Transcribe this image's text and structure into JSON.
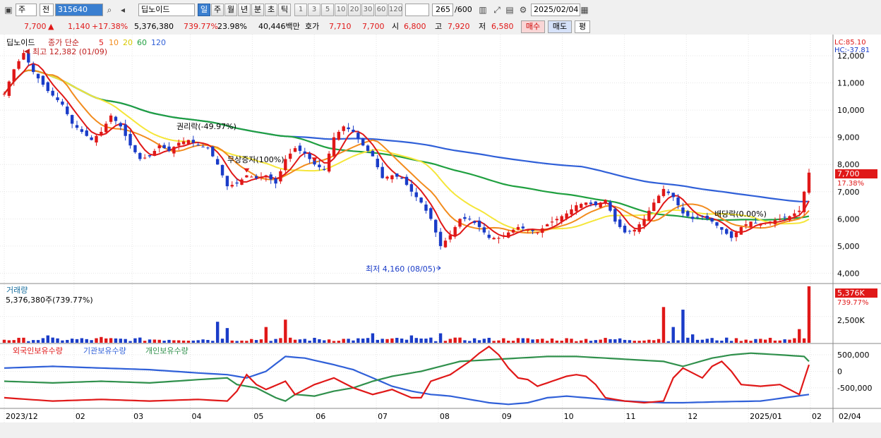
{
  "toolbar": {
    "market": "주",
    "mode": "전",
    "code": "315640",
    "name": "딥노이드",
    "periods": [
      "일",
      "주",
      "월",
      "년",
      "분",
      "초",
      "틱"
    ],
    "selected_period": "일",
    "ticks": [
      "1",
      "3",
      "5",
      "10",
      "20",
      "30",
      "60",
      "120"
    ],
    "count": "265",
    "count_total": "/600",
    "date": "2025/02/04"
  },
  "quote": {
    "price": "7,700",
    "change_arrow": "▲",
    "change": "1,140",
    "change_pct": "+17.38%",
    "volume": "5,376,380",
    "volume_ratio": "739.77%",
    "turnover": "23.98%",
    "amount": "40,446백만",
    "ask_label": "호가",
    "ask": "7,710",
    "bid": "7,700",
    "open_label": "시",
    "open": "6,800",
    "high_label": "고",
    "high": "7,920",
    "low_label": "저",
    "low": "6,580",
    "buy": "매수",
    "sell": "매도",
    "eval": "평"
  },
  "colors": {
    "up": "#e01818",
    "down": "#1a3cc8",
    "ma5": "#e01818",
    "ma10": "#f28c1e",
    "ma20": "#f5e63a",
    "ma60": "#20a040",
    "ma120": "#3060d8",
    "foreign": "#e01818",
    "institution": "#3060d8",
    "individual": "#30904c"
  },
  "chart_data": [
    {
      "type": "candlestick",
      "title": "딥노이드",
      "legend": [
        "종가 단순",
        "5",
        "10",
        "20",
        "60",
        "120"
      ],
      "ylim": [
        3700,
        12700
      ],
      "yticks": [
        "12,000",
        "11,000",
        "10,000",
        "9,000",
        "8,000",
        "7,000",
        "6,000",
        "5,000",
        "4,000"
      ],
      "corner_labels": [
        "LC:85.10",
        "HC:-37.81"
      ],
      "current_price": "7,700",
      "current_pct": "17.38%",
      "annotations": {
        "high": "최고 12,382 (01/09)",
        "low": "최저 4,160 (08/05)",
        "event1": "권리락(-49.97%)",
        "event2": "무상증자(100%)",
        "event3": "배당락(0.00%)"
      },
      "close_path": [
        [
          0,
          10600
        ],
        [
          2,
          11500
        ],
        [
          4,
          12100
        ],
        [
          6,
          11400
        ],
        [
          9,
          10700
        ],
        [
          12,
          10200
        ],
        [
          14,
          9500
        ],
        [
          16,
          9200
        ],
        [
          18,
          8900
        ],
        [
          20,
          9200
        ],
        [
          22,
          9800
        ],
        [
          24,
          9400
        ],
        [
          26,
          8700
        ],
        [
          28,
          8200
        ],
        [
          30,
          8300
        ],
        [
          32,
          8700
        ],
        [
          34,
          8500
        ],
        [
          36,
          8800
        ],
        [
          38,
          8900
        ],
        [
          40,
          8700
        ],
        [
          42,
          8600
        ],
        [
          44,
          8000
        ],
        [
          46,
          7200
        ],
        [
          48,
          7300
        ],
        [
          50,
          7600
        ],
        [
          52,
          7500
        ],
        [
          54,
          7600
        ],
        [
          56,
          7300
        ],
        [
          58,
          8200
        ],
        [
          60,
          8600
        ],
        [
          62,
          8400
        ],
        [
          64,
          8000
        ],
        [
          66,
          7800
        ],
        [
          68,
          9000
        ],
        [
          70,
          9400
        ],
        [
          72,
          9200
        ],
        [
          74,
          8700
        ],
        [
          76,
          8300
        ],
        [
          78,
          7500
        ],
        [
          80,
          7600
        ],
        [
          82,
          7500
        ],
        [
          84,
          7000
        ],
        [
          86,
          6600
        ],
        [
          88,
          6000
        ],
        [
          90,
          5000
        ],
        [
          92,
          5400
        ],
        [
          94,
          6000
        ],
        [
          96,
          6000
        ],
        [
          98,
          5700
        ],
        [
          100,
          5300
        ],
        [
          102,
          5300
        ],
        [
          104,
          5500
        ],
        [
          106,
          5700
        ],
        [
          108,
          5600
        ],
        [
          110,
          5500
        ],
        [
          112,
          5800
        ],
        [
          114,
          6000
        ],
        [
          116,
          6200
        ],
        [
          118,
          6500
        ],
        [
          120,
          6600
        ],
        [
          122,
          6500
        ],
        [
          124,
          6700
        ],
        [
          126,
          5900
        ],
        [
          128,
          5500
        ],
        [
          130,
          5600
        ],
        [
          132,
          6000
        ],
        [
          134,
          6600
        ],
        [
          136,
          7100
        ],
        [
          138,
          6800
        ],
        [
          140,
          6200
        ],
        [
          142,
          6000
        ],
        [
          144,
          6100
        ],
        [
          146,
          5900
        ],
        [
          148,
          5600
        ],
        [
          150,
          5300
        ],
        [
          152,
          5700
        ],
        [
          154,
          5900
        ],
        [
          156,
          5800
        ],
        [
          158,
          5900
        ],
        [
          160,
          6000
        ],
        [
          162,
          6100
        ],
        [
          164,
          6300
        ],
        [
          166,
          7700
        ]
      ],
      "volume": {
        "label": "거래량",
        "value_text": "5,376,380주(739.77%)",
        "current": "5,376K",
        "current_pct": "739.77%",
        "ytick": "2,500K",
        "ylim": [
          0,
          5500
        ],
        "bars_k": [
          [
            9,
            700
          ],
          [
            20,
            550
          ],
          [
            44,
            2000
          ],
          [
            46,
            1400
          ],
          [
            54,
            1500
          ],
          [
            58,
            2200
          ],
          [
            76,
            900
          ],
          [
            84,
            700
          ],
          [
            90,
            900
          ],
          [
            136,
            3400
          ],
          [
            138,
            1500
          ],
          [
            140,
            3150
          ],
          [
            142,
            800
          ],
          [
            164,
            1300
          ],
          [
            166,
            5376
          ]
        ]
      },
      "holdings": {
        "labels": [
          "외국인보유수량",
          "기관보유수량",
          "개인보유수량"
        ],
        "yticks": [
          "500,000",
          "0",
          "-500,000"
        ],
        "ylim": [
          -1100000,
          800000
        ],
        "foreign": [
          [
            0,
            -800000
          ],
          [
            10,
            -900000
          ],
          [
            20,
            -850000
          ],
          [
            30,
            -900000
          ],
          [
            40,
            -850000
          ],
          [
            46,
            -900000
          ],
          [
            48,
            -600000
          ],
          [
            50,
            -100000
          ],
          [
            52,
            -400000
          ],
          [
            54,
            -550000
          ],
          [
            58,
            -300000
          ],
          [
            60,
            -700000
          ],
          [
            64,
            -400000
          ],
          [
            68,
            -200000
          ],
          [
            72,
            -500000
          ],
          [
            76,
            -700000
          ],
          [
            80,
            -550000
          ],
          [
            84,
            -800000
          ],
          [
            86,
            -800000
          ],
          [
            88,
            -300000
          ],
          [
            92,
            -100000
          ],
          [
            96,
            300000
          ],
          [
            98,
            550000
          ],
          [
            100,
            750000
          ],
          [
            102,
            500000
          ],
          [
            104,
            100000
          ],
          [
            106,
            -200000
          ],
          [
            108,
            -250000
          ],
          [
            110,
            -450000
          ],
          [
            112,
            -350000
          ],
          [
            114,
            -250000
          ],
          [
            116,
            -150000
          ],
          [
            118,
            -100000
          ],
          [
            120,
            -150000
          ],
          [
            122,
            -400000
          ],
          [
            124,
            -800000
          ],
          [
            128,
            -900000
          ],
          [
            132,
            -950000
          ],
          [
            136,
            -900000
          ],
          [
            138,
            -200000
          ],
          [
            140,
            100000
          ],
          [
            144,
            -200000
          ],
          [
            146,
            150000
          ],
          [
            148,
            300000
          ],
          [
            150,
            0
          ],
          [
            152,
            -400000
          ],
          [
            156,
            -450000
          ],
          [
            160,
            -400000
          ],
          [
            164,
            -700000
          ],
          [
            166,
            200000
          ]
        ],
        "institution": [
          [
            0,
            100000
          ],
          [
            10,
            150000
          ],
          [
            20,
            100000
          ],
          [
            30,
            50000
          ],
          [
            40,
            -50000
          ],
          [
            46,
            -100000
          ],
          [
            50,
            -200000
          ],
          [
            54,
            0
          ],
          [
            58,
            450000
          ],
          [
            62,
            400000
          ],
          [
            68,
            200000
          ],
          [
            72,
            50000
          ],
          [
            76,
            -200000
          ],
          [
            80,
            -450000
          ],
          [
            84,
            -600000
          ],
          [
            88,
            -700000
          ],
          [
            92,
            -750000
          ],
          [
            96,
            -850000
          ],
          [
            100,
            -950000
          ],
          [
            104,
            -1000000
          ],
          [
            108,
            -950000
          ],
          [
            112,
            -800000
          ],
          [
            116,
            -750000
          ],
          [
            120,
            -800000
          ],
          [
            124,
            -850000
          ],
          [
            128,
            -900000
          ],
          [
            136,
            -950000
          ],
          [
            140,
            -950000
          ],
          [
            148,
            -920000
          ],
          [
            156,
            -900000
          ],
          [
            166,
            -700000
          ]
        ],
        "individual": [
          [
            0,
            -300000
          ],
          [
            10,
            -350000
          ],
          [
            20,
            -300000
          ],
          [
            30,
            -350000
          ],
          [
            40,
            -250000
          ],
          [
            46,
            -200000
          ],
          [
            48,
            -400000
          ],
          [
            52,
            -500000
          ],
          [
            56,
            -800000
          ],
          [
            58,
            -900000
          ],
          [
            60,
            -700000
          ],
          [
            64,
            -750000
          ],
          [
            68,
            -600000
          ],
          [
            72,
            -500000
          ],
          [
            76,
            -300000
          ],
          [
            80,
            -150000
          ],
          [
            86,
            0
          ],
          [
            90,
            150000
          ],
          [
            94,
            300000
          ],
          [
            100,
            350000
          ],
          [
            106,
            400000
          ],
          [
            112,
            450000
          ],
          [
            118,
            450000
          ],
          [
            124,
            400000
          ],
          [
            130,
            350000
          ],
          [
            136,
            300000
          ],
          [
            140,
            150000
          ],
          [
            146,
            400000
          ],
          [
            150,
            500000
          ],
          [
            154,
            550000
          ],
          [
            160,
            500000
          ],
          [
            165,
            450000
          ],
          [
            166,
            300000
          ]
        ]
      },
      "x_labels": [
        [
          0,
          "2023/12"
        ],
        [
          18,
          "02"
        ],
        [
          33,
          "03"
        ],
        [
          48,
          "04"
        ],
        [
          64,
          "05"
        ],
        [
          80,
          "06"
        ],
        [
          96,
          "07"
        ],
        [
          112,
          "08"
        ],
        [
          128,
          "09"
        ],
        [
          144,
          "10"
        ],
        [
          160,
          "11"
        ],
        [
          176,
          "12"
        ],
        [
          192,
          "2025/01"
        ],
        [
          208,
          "02"
        ]
      ],
      "x_right_label": "02/04"
    }
  ]
}
